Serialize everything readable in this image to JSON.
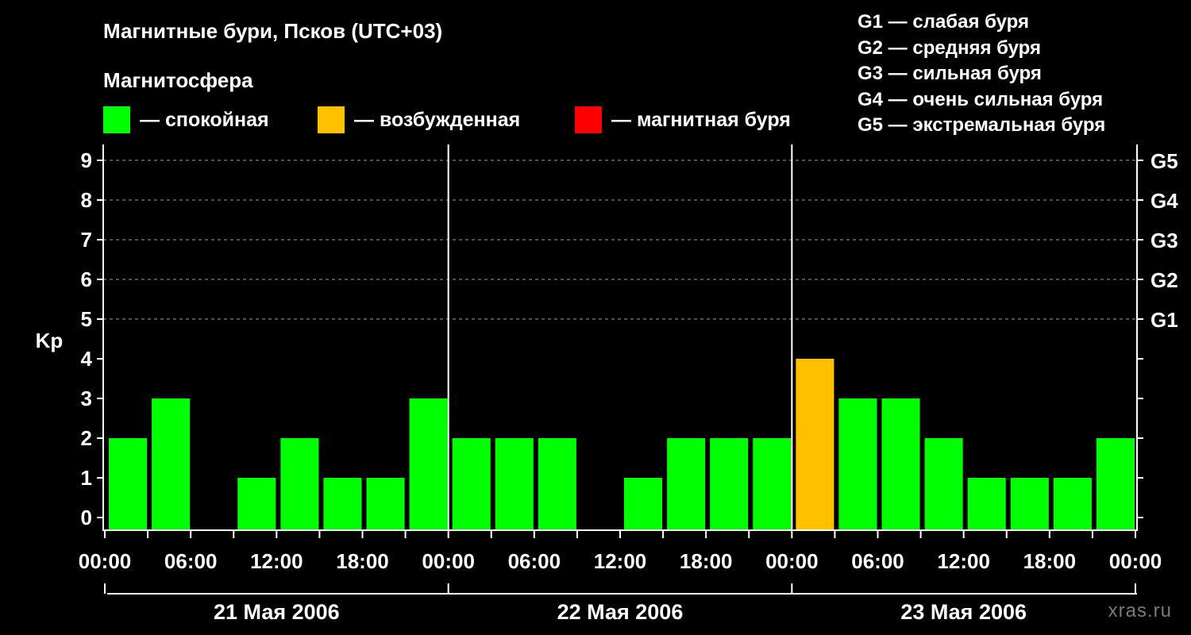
{
  "header": {
    "title": "Магнитные бури, Псков (UTC+03)",
    "legend_title": "Магнитосфера",
    "legend": [
      {
        "label": "— спокойная",
        "color": "#00ff00"
      },
      {
        "label": "— возбужденная",
        "color": "#ffc000"
      },
      {
        "label": "— магнитная буря",
        "color": "#ff0000"
      }
    ],
    "storm_scale": [
      "G1 — слабая буря",
      "G2 — средняя буря",
      "G3 — сильная буря",
      "G4 — очень сильная буря",
      "G5 — экстремальная буря"
    ],
    "watermark": "xras.ru"
  },
  "chart_data": {
    "type": "bar",
    "ylabel": "Kp",
    "ylim": [
      0,
      9
    ],
    "yticks": [
      "0",
      "1",
      "2",
      "3",
      "4",
      "5",
      "6",
      "7",
      "8",
      "9"
    ],
    "right_ticks": [
      {
        "value": 5,
        "label": "G1"
      },
      {
        "value": 6,
        "label": "G2"
      },
      {
        "value": 7,
        "label": "G3"
      },
      {
        "value": 8,
        "label": "G4"
      },
      {
        "value": 9,
        "label": "G5"
      }
    ],
    "xticks": [
      "00:00",
      "06:00",
      "12:00",
      "18:00",
      "00:00",
      "06:00",
      "12:00",
      "18:00",
      "00:00",
      "06:00",
      "12:00",
      "18:00",
      "00:00"
    ],
    "days": [
      "21 Мая 2006",
      "22 Мая 2006",
      "23 Мая 2006"
    ],
    "interval_hours": 3,
    "values": [
      2,
      3,
      0,
      1,
      2,
      1,
      1,
      3,
      2,
      2,
      2,
      0,
      1,
      2,
      2,
      2,
      4,
      3,
      3,
      2,
      1,
      1,
      1,
      2
    ],
    "colors": {
      "quiet": "#00ff00",
      "active": "#ffc000",
      "storm": "#ff0000"
    },
    "grid": "dashed at Kp 5-9"
  }
}
